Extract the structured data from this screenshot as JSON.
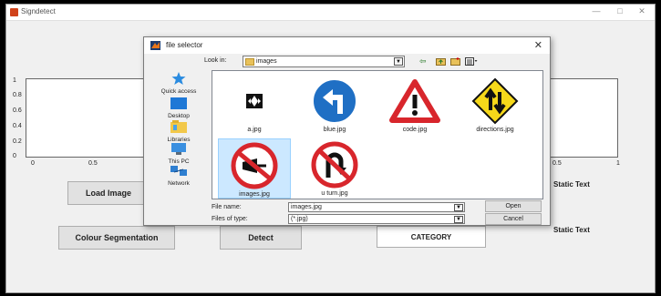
{
  "app": {
    "title": "Signdetect",
    "window_controls": {
      "minimize": "—",
      "maximize": "□",
      "close": "✕"
    }
  },
  "axes": {
    "y_ticks": [
      "1",
      "0.8",
      "0.6",
      "0.4",
      "0.2",
      "0"
    ],
    "x_ticks": [
      "0",
      "0.5",
      "0.5",
      "1"
    ]
  },
  "buttons": {
    "load_image": "Load Image",
    "colour_segmentation": "Colour Segmentation",
    "detect": "Detect",
    "category": "CATEGORY"
  },
  "static_texts": [
    "Static Text",
    "Static Text"
  ],
  "dialog": {
    "title": "file selector",
    "close": "✕",
    "look_in_label": "Look in:",
    "look_in_value": "images",
    "places": [
      {
        "label": "Quick access",
        "icon": "star-icon"
      },
      {
        "label": "Desktop",
        "icon": "desktop-icon"
      },
      {
        "label": "Libraries",
        "icon": "libraries-icon"
      },
      {
        "label": "This PC",
        "icon": "computer-icon"
      },
      {
        "label": "Network",
        "icon": "network-icon"
      }
    ],
    "files": [
      {
        "name": "a.jpg",
        "icon": "direction-arrows-sign"
      },
      {
        "name": "blue.jpg",
        "icon": "turn-left-sign"
      },
      {
        "name": "code.jpg",
        "icon": "warning-exclamation-sign"
      },
      {
        "name": "directions.jpg",
        "icon": "two-way-traffic-sign"
      },
      {
        "name": "images.jpg",
        "icon": "no-horn-sign",
        "selected": true
      },
      {
        "name": "u turn.jpg",
        "icon": "no-u-turn-sign"
      }
    ],
    "file_name_label": "File name:",
    "file_name_value": "images.jpg",
    "files_of_type_label": "Files of type:",
    "files_of_type_value": "(*.jpg)",
    "open": "Open",
    "cancel": "Cancel"
  },
  "colors": {
    "sign_red": "#d8262c",
    "sign_blue": "#1f6fc4",
    "sign_yellow": "#f6d81a",
    "selection": "#cce8ff"
  }
}
